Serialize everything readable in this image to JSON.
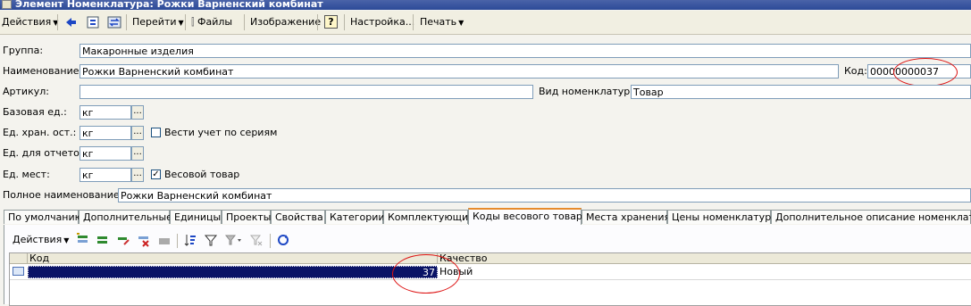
{
  "window": {
    "title": "Элемент Номенклатура: Рожки Варненский комбинат"
  },
  "toolbar": {
    "actions": "Действия",
    "goto": "Перейти",
    "files": "Файлы",
    "image": "Изображение",
    "help": "?",
    "settings": "Настройка...",
    "print": "Печать"
  },
  "form": {
    "group_label": "Группа:",
    "group_value": "Макаронные изделия",
    "name_label": "Наименование:",
    "name_value": "Рожки Варненский комбинат",
    "code_label": "Код:",
    "code_value": "00000000037",
    "article_label": "Артикул:",
    "article_value": "",
    "kind_label": "Вид номенклатуры:",
    "kind_value": "Товар",
    "base_unit_label": "Базовая ед.:",
    "base_unit_value": "кг",
    "storage_unit_label": "Ед. хран. ост.:",
    "storage_unit_value": "кг",
    "series_label": "Вести учет по сериям",
    "series_checked": false,
    "report_unit_label": "Ед. для отчетов:",
    "report_unit_value": "кг",
    "place_unit_label": "Ед. мест:",
    "place_unit_value": "кг",
    "weight_label": "Весовой товар",
    "weight_checked": true,
    "full_name_label": "Полное наименование:",
    "full_name_value": "Рожки Варненский комбинат"
  },
  "tabs": [
    "По умолчанию",
    "Дополнительные",
    "Единицы",
    "Проекты",
    "Свойства",
    "Категории",
    "Комплектующие",
    "Коды весового товара",
    "Места хранения",
    "Цены номенклатуры",
    "Дополнительное описание номенклатуры"
  ],
  "active_tab": "Коды весового товара",
  "table": {
    "actions": "Действия",
    "columns": [
      "Код",
      "Качество"
    ],
    "rows": [
      {
        "code": "37",
        "quality": "Новый"
      }
    ]
  },
  "colors": {
    "annotation": "#dd1111",
    "selection": "#0a1366"
  }
}
